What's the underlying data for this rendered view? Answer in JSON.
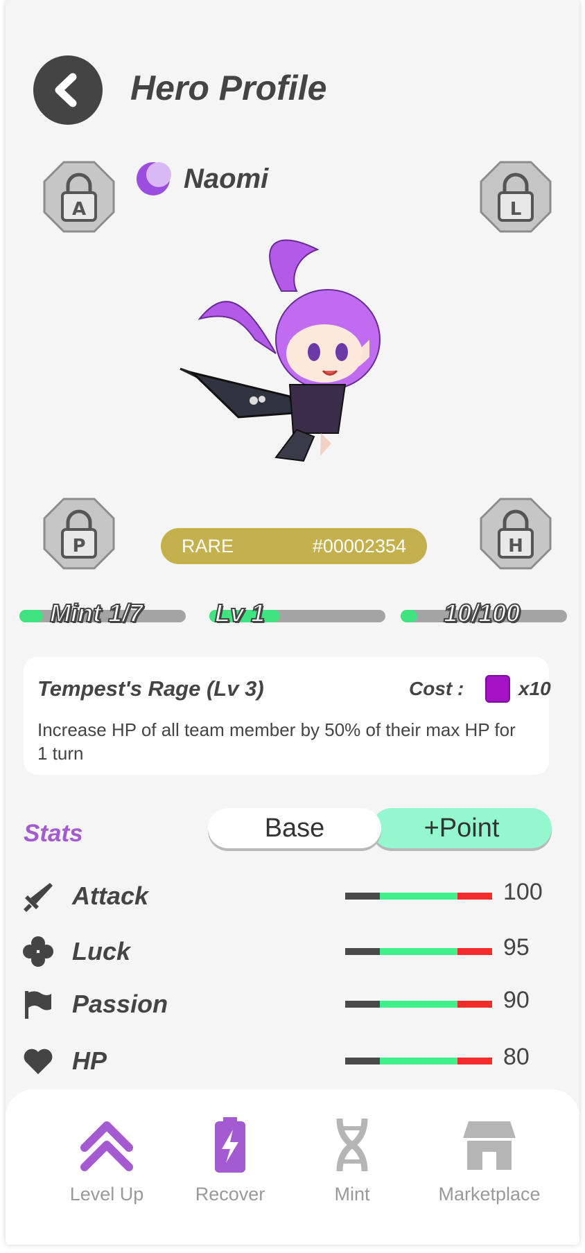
{
  "header": {
    "title": "Hero Profile"
  },
  "hero": {
    "name": "Naomi",
    "rarity": "RARE",
    "id": "#00002354",
    "slots": [
      {
        "letter": "A"
      },
      {
        "letter": "L"
      },
      {
        "letter": "P"
      },
      {
        "letter": "H"
      }
    ]
  },
  "progress": {
    "mint": {
      "label": "Mint 1/7",
      "fraction": 0.143
    },
    "level": {
      "label": "Lv 1",
      "fraction": 0.4
    },
    "exp": {
      "label": "10/100",
      "fraction": 0.1
    }
  },
  "skill": {
    "name": "Tempest's Rage (Lv 3)",
    "cost_label": "Cost :",
    "cost_qty": "x10",
    "description": "Increase HP of all team member by 50% of their max HP for 1 turn"
  },
  "stats": {
    "title": "Stats",
    "tabs": {
      "base": "Base",
      "point": "+Point"
    },
    "items": [
      {
        "name": "Attack",
        "value": "100",
        "icon": "sword-icon"
      },
      {
        "name": "Luck",
        "value": "95",
        "icon": "clover-icon"
      },
      {
        "name": "Passion",
        "value": "90",
        "icon": "flag-icon"
      },
      {
        "name": "HP",
        "value": "80",
        "icon": "heart-icon"
      }
    ]
  },
  "nav": {
    "items": [
      {
        "label": "Level Up",
        "icon": "double-chevron-up-icon",
        "color": "#a45ad0"
      },
      {
        "label": "Recover",
        "icon": "battery-bolt-icon",
        "color": "#a45ad0"
      },
      {
        "label": "Mint",
        "icon": "dna-icon",
        "color": "#b5b5b5"
      },
      {
        "label": "Marketplace",
        "icon": "store-icon",
        "color": "#b5b5b5"
      }
    ]
  },
  "colors": {
    "accent": "#a45ad0",
    "rarity": "#c4b04c",
    "progress_fill": "#3fe37f",
    "point_tab": "#94f7cd"
  }
}
